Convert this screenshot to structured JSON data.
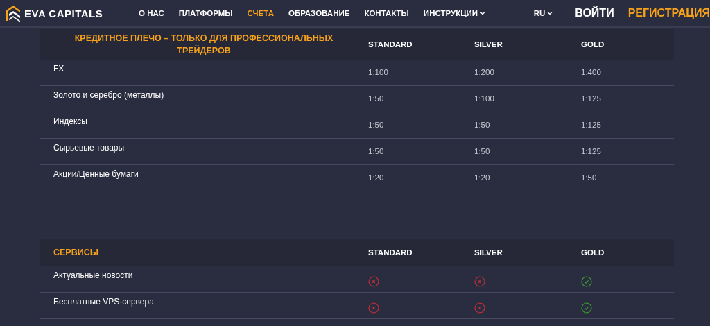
{
  "logo": {
    "text": "EVA CAPITALS"
  },
  "nav": [
    {
      "label": "О НАС",
      "selected": false,
      "dropdown": false
    },
    {
      "label": "ПЛАТФОРМЫ",
      "selected": false,
      "dropdown": false
    },
    {
      "label": "СЧЕТА",
      "selected": true,
      "dropdown": false
    },
    {
      "label": "ОБРАЗОВАНИЕ",
      "selected": false,
      "dropdown": false
    },
    {
      "label": "КОНТАКТЫ",
      "selected": false,
      "dropdown": false
    },
    {
      "label": "ИНСТРУКЦИИ",
      "selected": false,
      "dropdown": true
    }
  ],
  "language": "RU",
  "login": "ВОЙТИ",
  "register": "РЕГИСТРАЦИЯ",
  "leverage_table": {
    "columns": [
      "КРЕДИТНОЕ ПЛЕЧО – ТОЛЬКО ДЛЯ ПРОФЕССИОНАЛЬНЫХ ТРЕЙДЕРОВ",
      "STANDARD",
      "SILVER",
      "GOLD"
    ],
    "rows": [
      [
        "FX",
        "1:100",
        "1:200",
        "1:400"
      ],
      [
        "Золото и серебро (металлы)",
        "1:50",
        "1:100",
        "1:125"
      ],
      [
        "Индексы",
        "1:50",
        "1:50",
        "1:125"
      ],
      [
        "Сырьевые товары",
        "1:50",
        "1:50",
        "1:125"
      ],
      [
        "Акции/Ценные бумаги",
        "1:20",
        "1:20",
        "1:50"
      ]
    ]
  },
  "services_table": {
    "columns": [
      "СЕРВИСЫ",
      "STANDARD",
      "SILVER",
      "GOLD"
    ],
    "rows": [
      {
        "label": "Актуальные новости",
        "available": [
          false,
          false,
          true
        ]
      },
      {
        "label": "Бесплатные VPS-сервера",
        "available": [
          false,
          false,
          true
        ]
      }
    ]
  }
}
